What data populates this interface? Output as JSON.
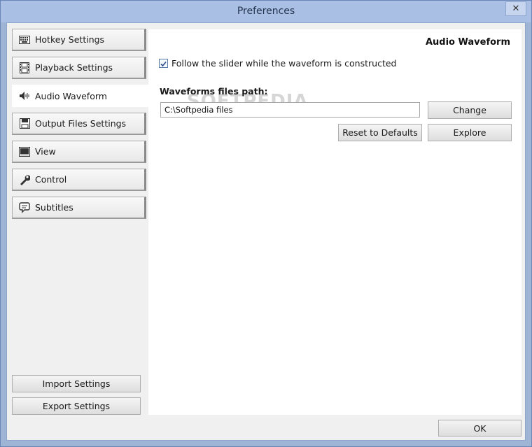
{
  "window": {
    "title": "Preferences",
    "close_glyph": "✕"
  },
  "sidebar": {
    "items": [
      {
        "label": "Hotkey Settings",
        "icon": "keyboard-icon"
      },
      {
        "label": "Playback Settings",
        "icon": "film-icon"
      },
      {
        "label": "Audio Waveform",
        "icon": "waveform-icon",
        "active": true
      },
      {
        "label": "Output Files Settings",
        "icon": "floppy-disk-icon"
      },
      {
        "label": "View",
        "icon": "monitor-icon"
      },
      {
        "label": "Control",
        "icon": "wrench-icon"
      },
      {
        "label": "Subtitles",
        "icon": "speech-bubble-icon"
      }
    ],
    "import_label": "Import Settings",
    "export_label": "Export Settings"
  },
  "panel": {
    "title": "Audio Waveform",
    "follow_slider_label": "Follow the slider while the waveform is constructed",
    "follow_slider_checked": true,
    "path_label": "Waveforms files path:",
    "path_value": "C:\\Softpedia files",
    "change_label": "Change",
    "reset_label": "Reset to Defaults",
    "explore_label": "Explore"
  },
  "footer": {
    "ok_label": "OK"
  },
  "watermark": "SOFTPEDIA"
}
